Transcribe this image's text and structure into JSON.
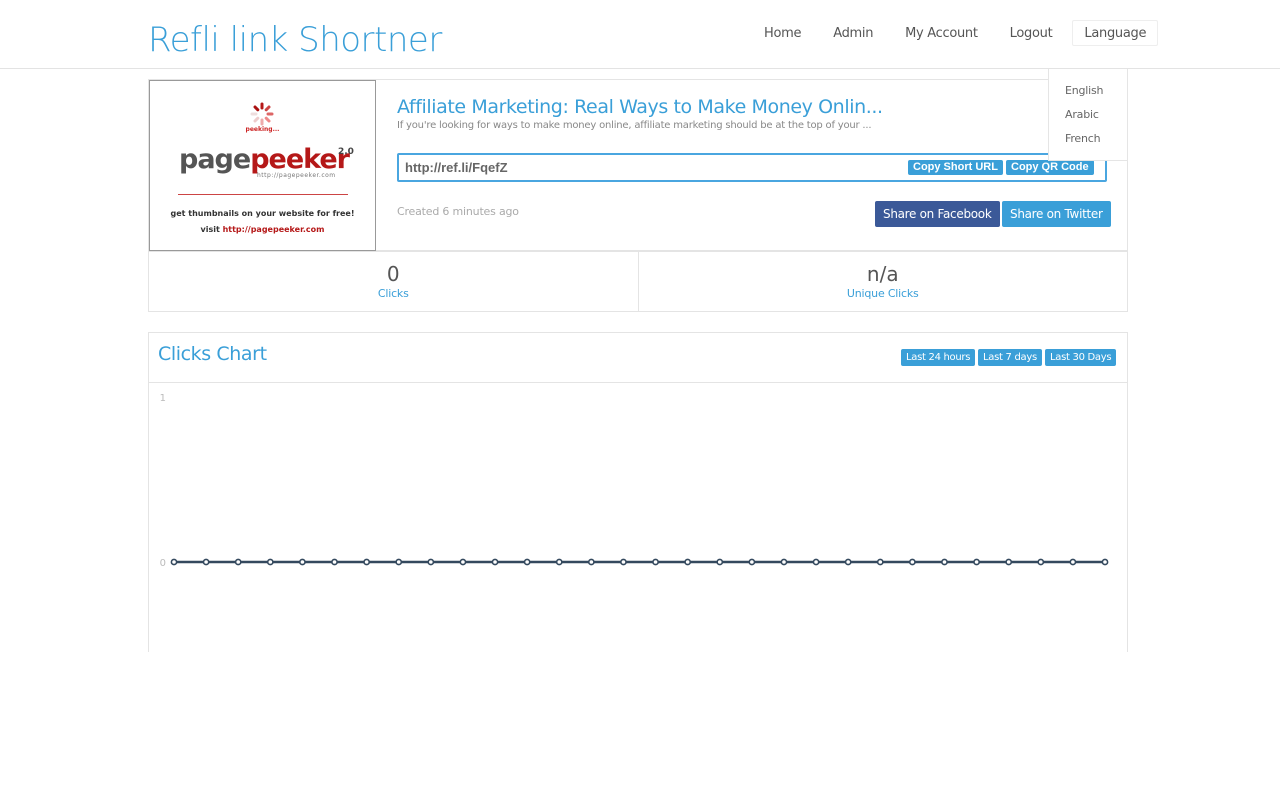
{
  "brand": "Refli link Shortner",
  "nav": {
    "items": [
      "Home",
      "Admin",
      "My Account",
      "Logout"
    ],
    "language": "Language",
    "languages": [
      "English",
      "Arabic",
      "French"
    ]
  },
  "link": {
    "title": "Affiliate Marketing: Real Ways to Make Money Onlin...",
    "description": "If you're looking for ways to make money online, affiliate marketing should be at the top of your ...",
    "short_url": "http://ref.li/FqefZ",
    "copy_url_label": "Copy Short URL",
    "copy_qr_label": "Copy QR Code",
    "created": "Created 6 minutes ago",
    "share_facebook": "Share on Facebook",
    "share_twitter": "Share on Twitter"
  },
  "thumbnail": {
    "peeking": "peeking...",
    "logo_a": "page",
    "logo_b": "peeker",
    "version": "2.0",
    "site": "http://pagepeeker.com",
    "line1": "get thumbnails on your website for free!",
    "line2_prefix": "visit ",
    "line2_link": "http://pagepeeker.com"
  },
  "stats": {
    "clicks_value": "0",
    "clicks_label": "Clicks",
    "unique_value": "n/a",
    "unique_label": "Unique Clicks"
  },
  "chart_panel": {
    "title": "Clicks Chart",
    "ranges": [
      "Last 24 hours",
      "Last 7 days",
      "Last 30 Days"
    ]
  },
  "colors": {
    "accent": "#3a9fd8",
    "facebook": "#3b5998",
    "line": "#34495e"
  },
  "chart_data": {
    "type": "line",
    "title": "",
    "xlabel": "",
    "ylabel": "",
    "yticks": [
      "1",
      "0"
    ],
    "ylim": [
      0,
      1
    ],
    "grid": false,
    "series": [
      {
        "values": [
          0,
          0,
          0,
          0,
          0,
          0,
          0,
          0,
          0,
          0,
          0,
          0,
          0,
          0,
          0,
          0,
          0,
          0,
          0,
          0,
          0,
          0,
          0,
          0,
          0,
          0,
          0,
          0,
          0,
          0
        ]
      }
    ]
  }
}
